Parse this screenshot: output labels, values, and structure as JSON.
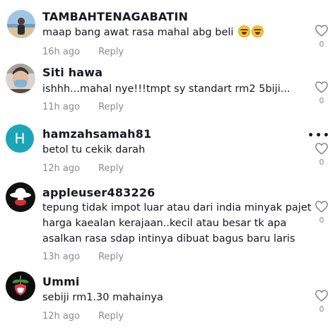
{
  "comments": [
    {
      "username": "TAMBAHTENAGABATIN",
      "text": "maap bang awat rasa mahal abg beli",
      "emojis": [
        "laughing-with-tears-emoji",
        "laughing-with-tears-emoji"
      ],
      "time": "16h ago",
      "reply_label": "Reply",
      "like_count": "0",
      "avatar": "beach-photo-avatar"
    },
    {
      "username": "Siti hawa",
      "text": "ishhh...mahal nye!!!tmpt sy standart rm2 5biji...",
      "time": "11h ago",
      "reply_label": "Reply",
      "like_count": "0",
      "avatar": "masked-person-avatar"
    },
    {
      "username": "hamzahsamah81",
      "text": "betol tu cekik darah",
      "time": "12h ago",
      "reply_label": "Reply",
      "like_count": "0",
      "avatar_letter": "H",
      "avatar_color": "#1aa6b7"
    },
    {
      "username": "appleuser483226",
      "text_lines": [
        "tepung tidak impot luar atau dari india minyak pajet",
        "harga kaealan kerajaan..kecil atau besar tk apa",
        "asalkan rasa sdap intinya dibuat bagus baru laris"
      ],
      "time": "13h ago",
      "reply_label": "Reply",
      "like_count": "0",
      "avatar": "hat-silhouette-avatar"
    },
    {
      "username": "Ummi",
      "text": "sebiji rm1.30 mahainya",
      "time": "12h ago",
      "reply_label": "Reply",
      "like_count": "0",
      "avatar": "flower-avatar"
    }
  ],
  "colors": {
    "text": "#161823",
    "muted": "#8a8b91"
  }
}
